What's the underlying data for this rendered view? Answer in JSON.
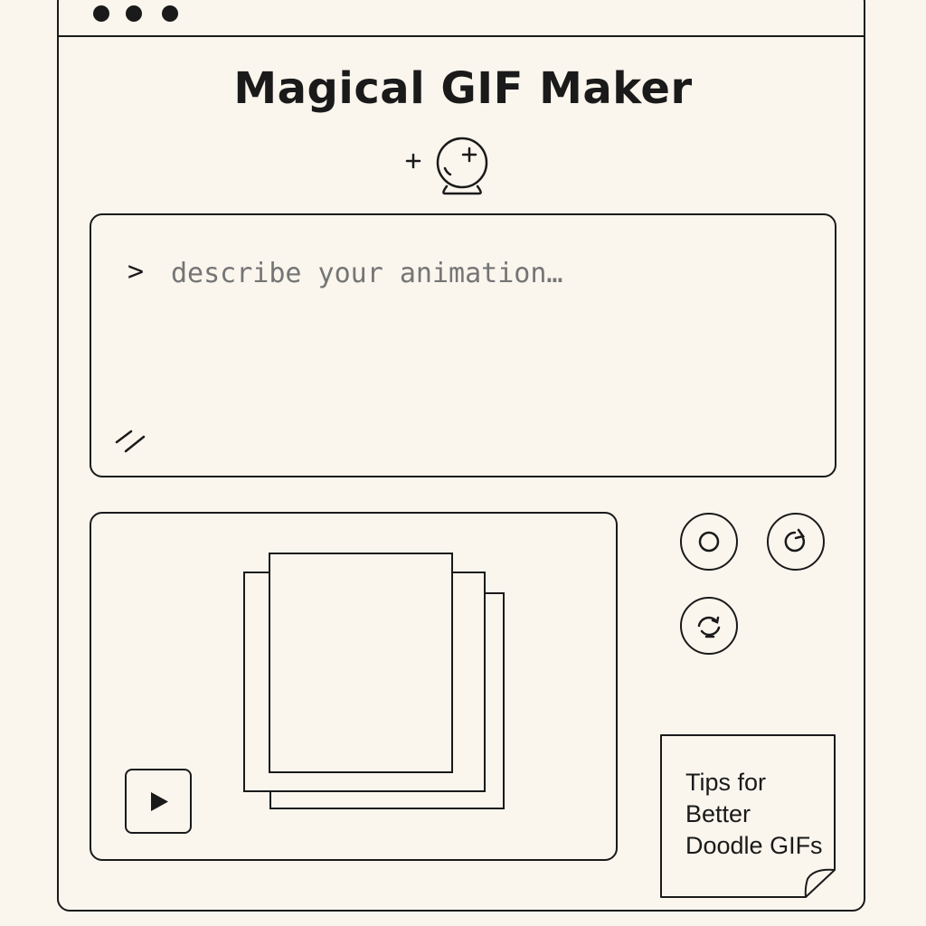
{
  "app": {
    "title": "Magical GIF Maker",
    "window_controls": [
      "dot",
      "dot",
      "dot"
    ]
  },
  "logo": {
    "icon": "crystal-ball-icon",
    "sparkle": "+"
  },
  "prompt": {
    "caret": ">",
    "placeholder": "describe your animation…"
  },
  "preview": {
    "frames_icon": "stacked-frames",
    "play_icon": "play-icon"
  },
  "controls": [
    {
      "name": "record-button",
      "icon": "circle-icon"
    },
    {
      "name": "redo-button",
      "icon": "rotate-clockwise-icon"
    },
    {
      "name": "loop-button",
      "icon": "loop-icon"
    }
  ],
  "tips": {
    "label": "Tips for Better Doodle GIFs"
  },
  "colors": {
    "background": "#faf6ee",
    "ink": "#1a1a1a"
  }
}
